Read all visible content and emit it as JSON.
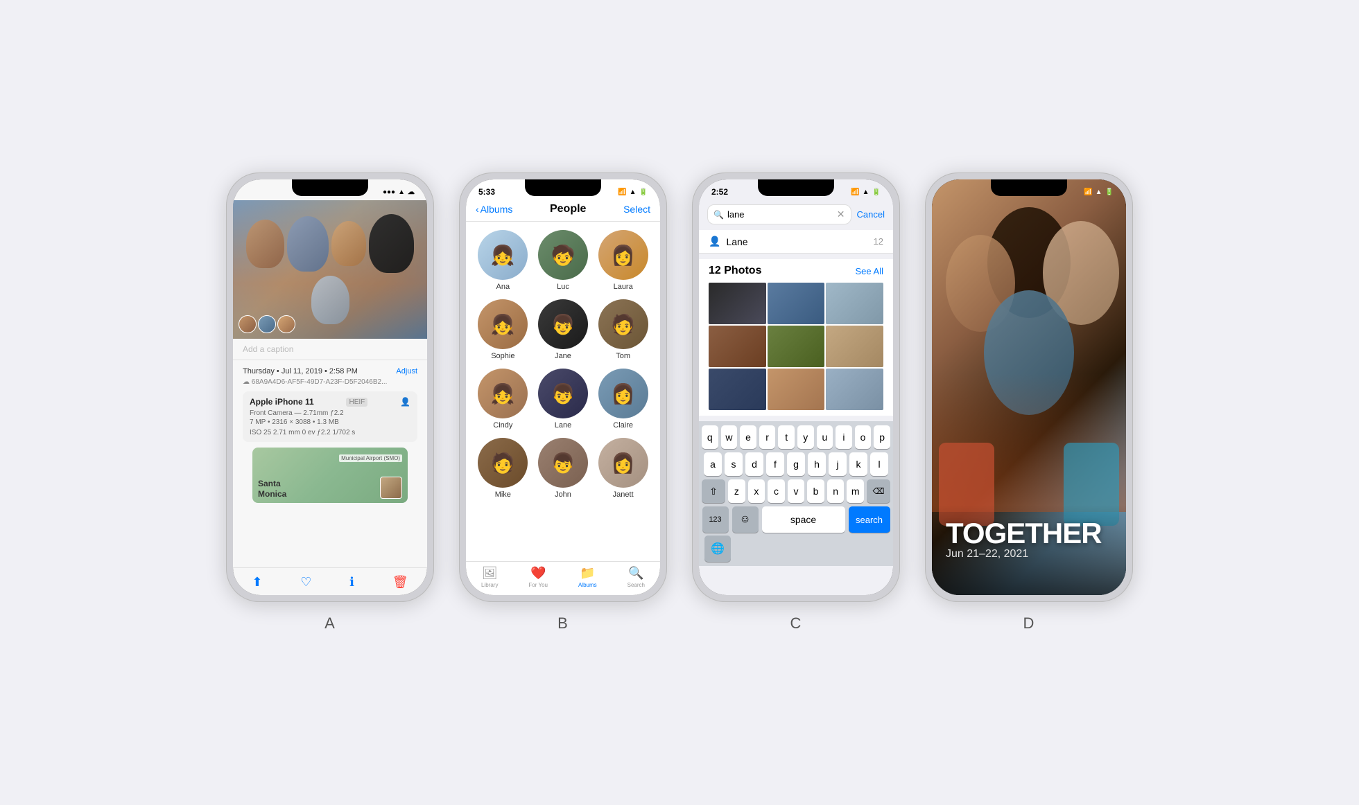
{
  "phones": {
    "a": {
      "label": "A",
      "status": {
        "time": "",
        "icons": "●●● ▲ ☁"
      },
      "caption_placeholder": "Add a caption",
      "date": "Thursday • Jul 11, 2019 • 2:58 PM",
      "adjust": "Adjust",
      "cloud": "☁ 68A9A4D6-AF5F-49D7-A23F-D5F2046B2...",
      "device_name": "Apple iPhone 11",
      "format": "HEIF",
      "camera": "Front Camera — 2.71mm ƒ2.2",
      "specs": "7 MP • 2316 × 3088 • 1.3 MB",
      "exif": "ISO 25  2.71 mm  0 ev  ƒ2.2  1/702 s",
      "map_location": "Santa\nMonica",
      "map_airport": "Municipal Airport (SMO)"
    },
    "b": {
      "label": "B",
      "status_time": "5:33",
      "nav_back": "Albums",
      "nav_title": "People",
      "nav_select": "Select",
      "people": [
        {
          "name": "Ana",
          "av": "av-ana"
        },
        {
          "name": "Luc",
          "av": "av-luc"
        },
        {
          "name": "Laura",
          "av": "av-laura"
        },
        {
          "name": "Sophie",
          "av": "av-sophie"
        },
        {
          "name": "Jane",
          "av": "av-jane"
        },
        {
          "name": "Tom",
          "av": "av-tom"
        },
        {
          "name": "Cindy",
          "av": "av-cindy"
        },
        {
          "name": "Lane",
          "av": "av-lane"
        },
        {
          "name": "Claire",
          "av": "av-claire"
        },
        {
          "name": "Mike",
          "av": "av-mike"
        },
        {
          "name": "John",
          "av": "av-john"
        },
        {
          "name": "Janett",
          "av": "av-janett"
        }
      ],
      "tabs": [
        {
          "label": "Library",
          "icon": "🖼",
          "active": false
        },
        {
          "label": "For You",
          "icon": "❤️",
          "active": false
        },
        {
          "label": "Albums",
          "icon": "📁",
          "active": true
        },
        {
          "label": "Search",
          "icon": "🔍",
          "active": false
        }
      ]
    },
    "c": {
      "label": "C",
      "status_time": "2:52",
      "search_value": "lane",
      "cancel_label": "Cancel",
      "suggestion_name": "Lane",
      "suggestion_count": "12",
      "results_title": "12 Photos",
      "see_all": "See All",
      "keyboard_rows": [
        [
          "q",
          "w",
          "e",
          "r",
          "t",
          "y",
          "u",
          "i",
          "o",
          "p"
        ],
        [
          "a",
          "s",
          "d",
          "f",
          "g",
          "h",
          "j",
          "k",
          "l"
        ],
        [
          "z",
          "x",
          "c",
          "v",
          "b",
          "n",
          "m"
        ]
      ],
      "key_123": "123",
      "key_space": "space",
      "key_search": "search"
    },
    "d": {
      "label": "D",
      "title": "TOGETHER",
      "dates": "Jun 21–22, 2021"
    }
  }
}
